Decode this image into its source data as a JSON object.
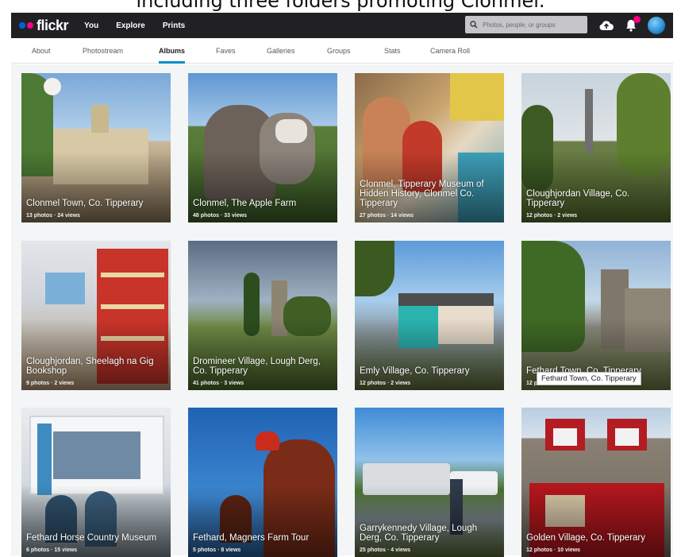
{
  "caption": "including three folders promoting Clonmel.",
  "brand": {
    "logo_text": "flickr"
  },
  "topbar": {
    "nav": [
      "You",
      "Explore",
      "Prints"
    ],
    "search_placeholder": "Photos, people, or groups"
  },
  "subnav": {
    "items": [
      "About",
      "Photostream",
      "Albums",
      "Faves",
      "Galleries",
      "Groups",
      "Stats",
      "Camera Roll"
    ],
    "active": "Albums"
  },
  "albums": [
    {
      "title": "Clonmel Town, Co. Tipperary",
      "meta": "13 photos  ·  24 views"
    },
    {
      "title": "Clonmel, The Apple Farm",
      "meta": "48 photos  ·  33 views"
    },
    {
      "title": "Clonmel, Tipperary Museum of Hidden History, Clonmel Co. Tipperary",
      "meta": "27 photos  ·  14 views"
    },
    {
      "title": "Cloughjordan Village, Co. Tipperary",
      "meta": "12 photos  ·  2 views"
    },
    {
      "title": "Cloughjordan, Sheelagh na Gig Bookshop",
      "meta": "9 photos  ·  2 views"
    },
    {
      "title": "Dromineer Village, Lough Derg, Co. Tipperary",
      "meta": "41 photos  ·  3 views"
    },
    {
      "title": "Emly Village, Co. Tipperary",
      "meta": "12 photos  ·  2 views"
    },
    {
      "title": "Fethard Town, Co. Tipperary",
      "meta": "12 photos  ·  24 views"
    },
    {
      "title": "Fethard Horse Country Museum",
      "meta": "6 photos  ·  15 views"
    },
    {
      "title": "Fethard, Magners Farm Tour",
      "meta": "5 photos  ·  8 views"
    },
    {
      "title": "Garrykennedy Village, Lough Derg, Co. Tipperary",
      "meta": "25 photos  ·  4 views"
    },
    {
      "title": "Golden Village, Co. Tipperary",
      "meta": "12 photos  ·  10 views"
    }
  ],
  "tooltip": "Fethard Town, Co. Tipperary",
  "colors": {
    "topbar": "#212124",
    "brand_blue": "#0063dc",
    "brand_pink": "#ff0084",
    "active_tab_underline": "#008ecf"
  }
}
